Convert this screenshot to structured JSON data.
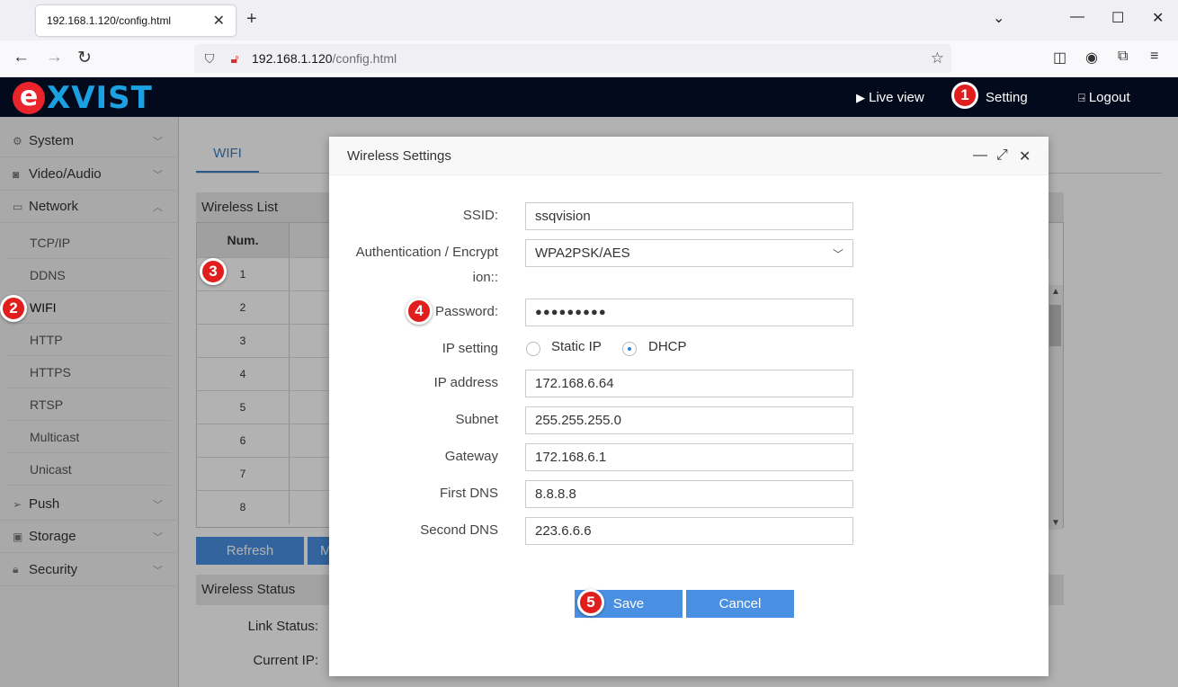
{
  "browser": {
    "tab_title": "192.168.1.120/config.html",
    "tab_close": "✕",
    "new_tab": "+",
    "url_host": "192.168.1.120",
    "url_path": "/config.html"
  },
  "header": {
    "logo_e": "e",
    "logo_rest": "XVIST",
    "live_view": "Live view",
    "setting": "Setting",
    "logout": "Logout"
  },
  "markers": [
    "1",
    "2",
    "3",
    "4",
    "5"
  ],
  "sidebar": {
    "groups_top": [
      {
        "label": "System",
        "icon": "gear-icon"
      },
      {
        "label": "Video/Audio",
        "icon": "camera-icon"
      },
      {
        "label": "Network",
        "icon": "monitor-icon"
      }
    ],
    "network_items": [
      "TCP/IP",
      "DDNS",
      "WIFI",
      "HTTP",
      "HTTPS",
      "RTSP",
      "Multicast",
      "Unicast"
    ],
    "groups_bottom": [
      {
        "label": "Push",
        "icon": "send-icon"
      },
      {
        "label": "Storage",
        "icon": "save-icon"
      },
      {
        "label": "Security",
        "icon": "lock-icon"
      }
    ]
  },
  "main": {
    "tab": "WIFI",
    "wireless_list": "Wireless List",
    "num_header": "Num.",
    "rows": [
      "1",
      "2",
      "3",
      "4",
      "5",
      "6",
      "7",
      "8"
    ],
    "refresh": "Refresh",
    "modify_partial": "M",
    "wireless_status": "Wireless Status",
    "link_status": "Link Status:",
    "current_ip": "Current IP:"
  },
  "dialog": {
    "title": "Wireless Settings",
    "ssid_label": "SSID:",
    "ssid": "ssqvision",
    "auth_label_1": "Authentication / Encrypt",
    "auth_label_2": "ion::",
    "auth_value": "WPA2PSK/AES",
    "password_label": "Password:",
    "password": "●●●●●●●●●",
    "ip_setting_label": "IP setting",
    "static_ip": "Static IP",
    "dhcp": "DHCP",
    "ip_mode_selected": "DHCP",
    "ip_address_label": "IP address",
    "ip_address": "172.168.6.64",
    "subnet_label": "Subnet",
    "subnet": "255.255.255.0",
    "gateway_label": "Gateway",
    "gateway": "172.168.6.1",
    "dns1_label": "First DNS",
    "dns1": "8.8.8.8",
    "dns2_label": "Second DNS",
    "dns2": "223.6.6.6",
    "save": "Save",
    "cancel": "Cancel"
  },
  "colors": {
    "accent": "#4a90e2",
    "header_bg": "#030a1c",
    "marker": "#e01e1e",
    "logo_red": "#e9252b",
    "logo_blue": "#1ba1e2"
  }
}
